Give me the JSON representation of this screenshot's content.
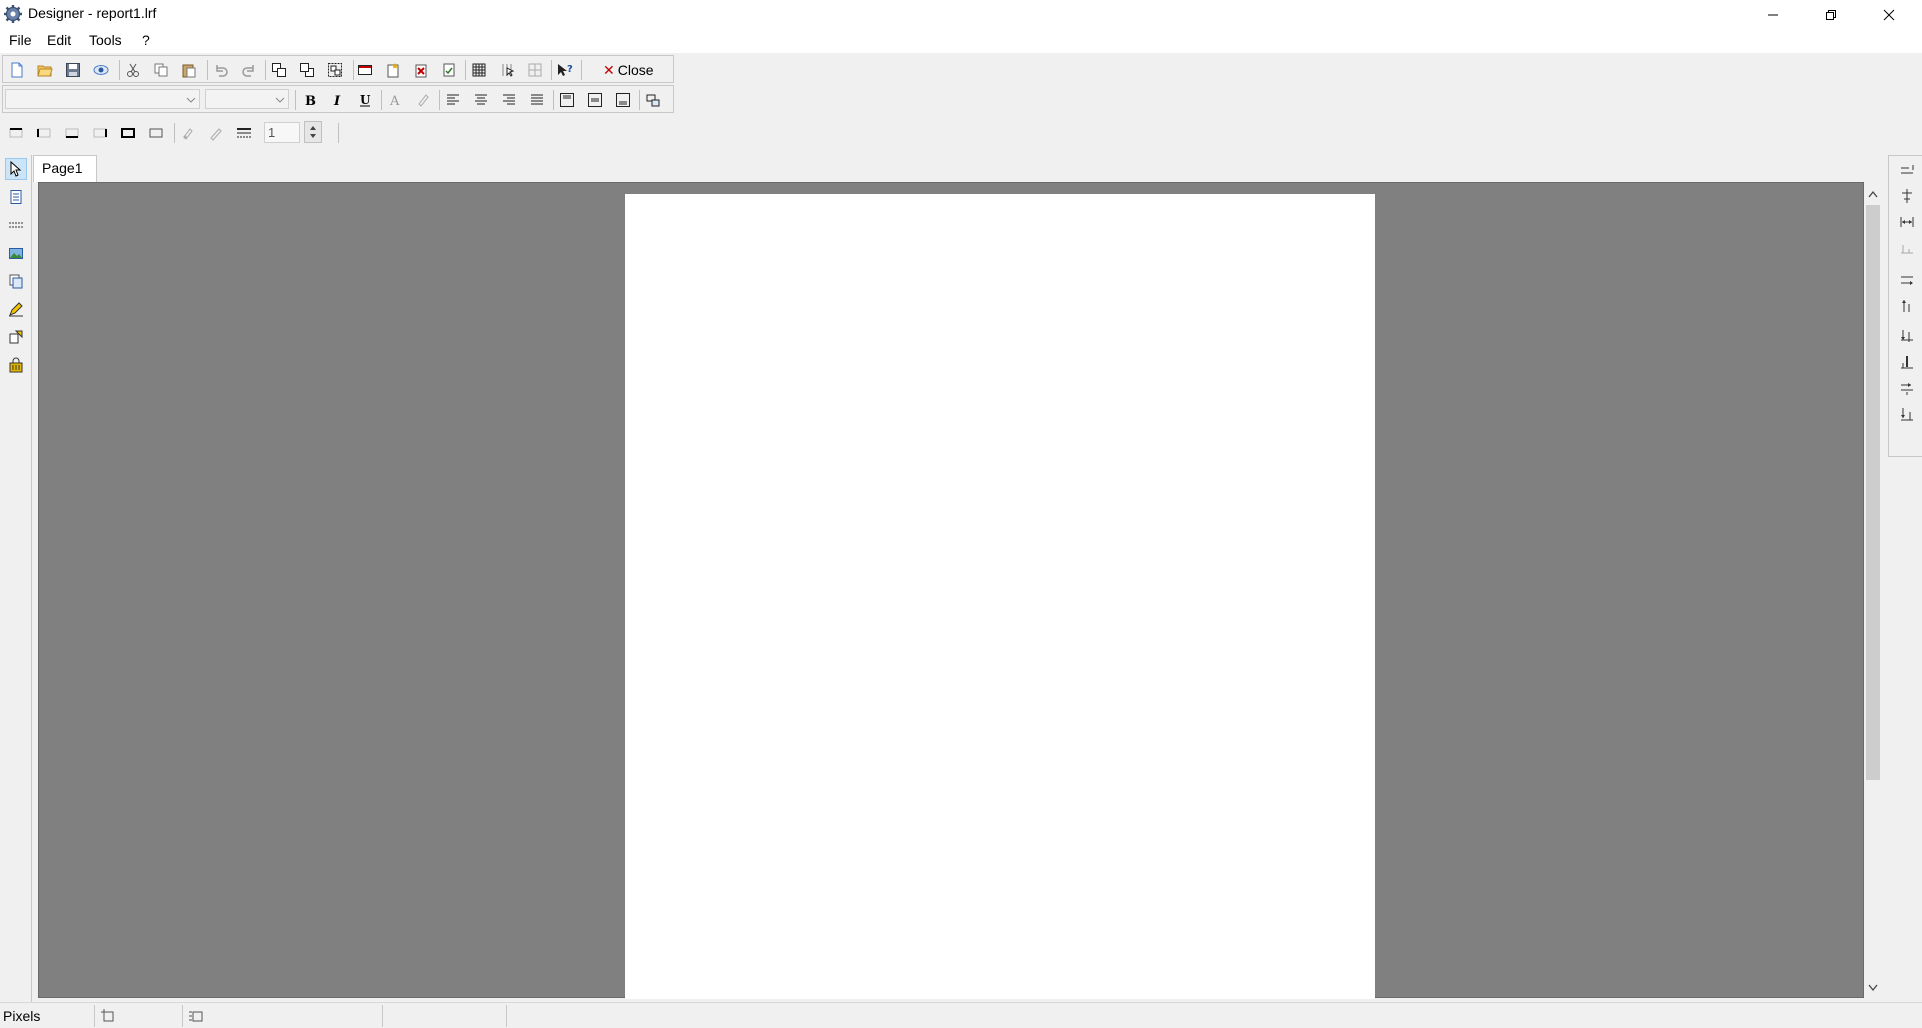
{
  "window": {
    "title": "Designer - report1.lrf",
    "controls": [
      "minimize-icon",
      "restore-icon",
      "close-icon"
    ]
  },
  "menu": {
    "items": [
      {
        "label": "File"
      },
      {
        "label": "Edit"
      },
      {
        "label": "Tools"
      },
      {
        "label": "?"
      }
    ]
  },
  "toolbar": {
    "close_label": "Close",
    "font_name": "",
    "font_size": "",
    "line_width": "1"
  },
  "tabs": [
    {
      "label": "Page1"
    }
  ],
  "status": {
    "units": "Pixels"
  },
  "colors": {
    "canvas": "#808080",
    "page": "#ffffff",
    "accent": "#c00000"
  }
}
